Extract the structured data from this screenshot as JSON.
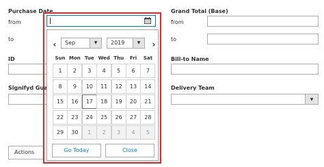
{
  "filters": {
    "purchase_date": {
      "label": "Purchase Date",
      "from_label": "from",
      "to_label": "to"
    },
    "grand_total": {
      "label": "Grand Total (Base)",
      "from_label": "from",
      "to_label": "to"
    },
    "id": {
      "label": "ID"
    },
    "bill_to_name": {
      "label": "Bill-to Name"
    },
    "signifyd": {
      "label": "Signifyd Guara"
    },
    "delivery_team": {
      "label": "Delivery Team"
    }
  },
  "calendar": {
    "prev_symbol": "‹",
    "next_symbol": "›",
    "month": "Sep",
    "year": "2019",
    "days_of_week": [
      "Sun",
      "Mon",
      "Tue",
      "Wed",
      "Thu",
      "Fri",
      "Sat"
    ],
    "weeks": [
      [
        "1",
        "2",
        "3",
        "4",
        "5",
        "6",
        "7"
      ],
      [
        "8",
        "9",
        "10",
        "11",
        "12",
        "13",
        "14"
      ],
      [
        "15",
        "16",
        "17",
        "18",
        "19",
        "20",
        "21"
      ],
      [
        "22",
        "23",
        "24",
        "25",
        "26",
        "27",
        "28"
      ],
      [
        "29",
        "30",
        "1",
        "2",
        "3",
        "4",
        "5"
      ]
    ],
    "today": "17",
    "go_today_label": "Go Today",
    "close_label": "Close"
  },
  "actions_label": "Actions",
  "colors": {
    "highlight": "#e02b27",
    "link_blue": "#007bdb"
  },
  "icons": {
    "calendar": "calendar-icon",
    "dropdown": "chevron-down-icon"
  }
}
